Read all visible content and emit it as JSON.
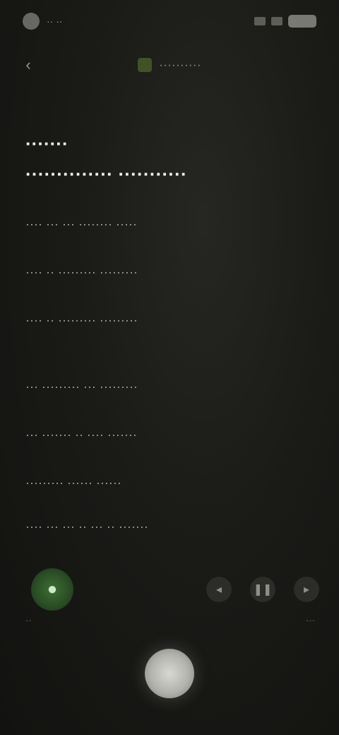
{
  "status_bar": {
    "time": "·· ··",
    "right_glyphs": [
      "signal-icon",
      "wifi-icon",
      "battery-icon"
    ]
  },
  "top_bar": {
    "back_icon": "back-arrow-icon",
    "title": "··········"
  },
  "content": {
    "headline_line1": "·······",
    "headline_line2": "·············· ···········",
    "lines": [
      "···· ··· ··· ········ ·····",
      "···· ·· ········· ·········",
      "···· ·· ········· ·········",
      "",
      "··· ········· ··· ·········",
      "··· ······· ·· ···· ·······",
      "········· ······ ······",
      "···· ··· ··· ·· ··· ·· ·······"
    ]
  },
  "controls": {
    "primary_icon": "mic-icon",
    "secondary_icons": [
      "prev-icon",
      "pause-icon",
      "next-icon"
    ],
    "left_label": "··",
    "right_label": "···"
  },
  "colors": {
    "accent_green": "#3e6f34",
    "background": "#141412",
    "text_primary": "#ededea",
    "text_secondary": "#9e9e98"
  }
}
